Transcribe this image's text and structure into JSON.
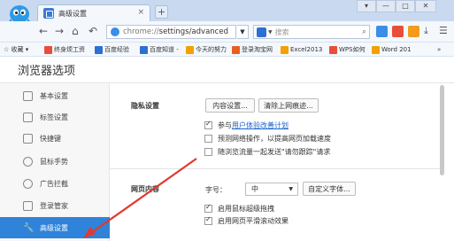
{
  "window": {
    "tab_title": "高级设置",
    "tab_close": "×",
    "new_tab": "+",
    "controls": [
      "▾",
      "—",
      "□",
      "✕"
    ]
  },
  "toolbar": {
    "back": "←",
    "forward": "→",
    "home": "⌂",
    "undo": "↶",
    "url_scheme": "chrome://",
    "url_path": "settings/advanced",
    "search_placeholder": "搜索",
    "search_icon": "search-icon"
  },
  "bookmarks": [
    {
      "label": "☆ 收藏 ▾",
      "color": ""
    },
    {
      "label": "终身烦工资",
      "color": "#e94e3b"
    },
    {
      "label": "百度经验",
      "color": "#2d6fd3"
    },
    {
      "label": "百度知道 -",
      "color": "#2d6fd3"
    },
    {
      "label": "今天的努力",
      "color": "#f4a000"
    },
    {
      "label": "登录淘宝网",
      "color": "#e85d22"
    },
    {
      "label": "Excel2013",
      "color": "#f4a000"
    },
    {
      "label": "WPS如何",
      "color": "#e94e3b"
    },
    {
      "label": "Word 201",
      "color": "#f4a000"
    },
    {
      "label": "»",
      "color": ""
    }
  ],
  "page_title": "浏览器选项",
  "sidebar": {
    "items": [
      {
        "label": "基本设置",
        "icon": "gear-icon"
      },
      {
        "label": "标签设置",
        "icon": "tab-icon"
      },
      {
        "label": "快捷键",
        "icon": "keyboard-icon"
      },
      {
        "label": "鼠标手势",
        "icon": "mouse-icon"
      },
      {
        "label": "广告拦截",
        "icon": "block-icon"
      },
      {
        "label": "登录管家",
        "icon": "lock-icon"
      },
      {
        "label": "高级设置",
        "icon": "wrench-icon"
      }
    ],
    "active_index": 6
  },
  "privacy": {
    "label": "隐私设置",
    "content_button": "内容设置...",
    "clear_button": "清除上网痕迹...",
    "options": [
      {
        "prefix": "参与",
        "link": "用户体验改善计划",
        "checked": true
      },
      {
        "prefix": "预测网络操作，以提高网页加载速度",
        "link": "",
        "checked": false
      },
      {
        "prefix": "随浏览流量一起发送\"请勿跟踪\"请求",
        "link": "",
        "checked": false
      }
    ]
  },
  "web_content": {
    "label": "网页内容",
    "font_size_label": "字号：",
    "font_size_value": "中",
    "custom_font_button": "自定义字体...",
    "options": [
      {
        "label": "启用鼠标超级拖拽",
        "checked": true
      },
      {
        "label": "启用网页平滑滚动效果",
        "checked": true
      }
    ]
  },
  "colors": {
    "accent": "#2f83d8",
    "link": "#1a62c9",
    "arrow": "#e03a2f"
  }
}
